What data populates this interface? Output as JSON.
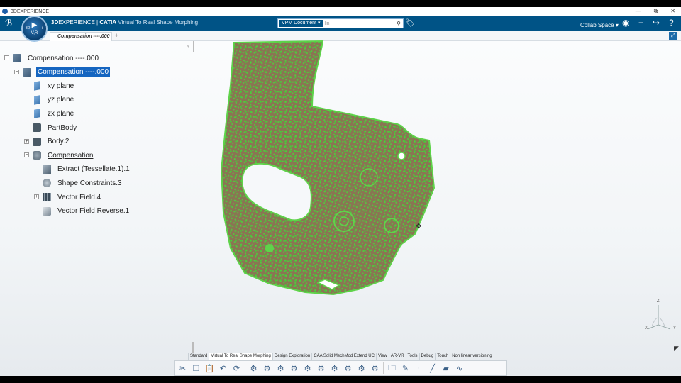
{
  "window": {
    "title": "3DEXPERIENCE",
    "controls": {
      "minimize": "—",
      "restore": "⧉",
      "close": "✕"
    }
  },
  "header": {
    "brand_bold": "3D",
    "brand_rest": "EXPERIENCE | ",
    "brand_catia": "CATIA",
    "app_name": "Virtual To Real Shape Morphing",
    "compass": {
      "left": "3D",
      "right": "i",
      "play": "▶",
      "version": "V,R"
    },
    "search": {
      "scope": "VPM Document",
      "value": "lin",
      "icon": "search-icon"
    },
    "collab_space": "Collab Space",
    "icons": [
      "tag-icon",
      "user-icon",
      "add-icon",
      "share-icon",
      "help-icon"
    ]
  },
  "tabs": [
    {
      "label": "Compensation ----.000",
      "active": true
    }
  ],
  "tree": {
    "nodes": [
      {
        "label": "Compensation ----.000",
        "icon": "product-icon",
        "depth": 0,
        "toggle": "minus",
        "selected": false,
        "underline": false
      },
      {
        "label": "Compensation ----.000",
        "icon": "part-icon",
        "depth": 1,
        "toggle": "minus",
        "selected": true,
        "underline": false
      },
      {
        "label": "xy plane",
        "icon": "plane-icon",
        "depth": 2,
        "toggle": "",
        "selected": false,
        "underline": false
      },
      {
        "label": "yz plane",
        "icon": "plane-icon",
        "depth": 2,
        "toggle": "",
        "selected": false,
        "underline": false
      },
      {
        "label": "zx plane",
        "icon": "plane-icon",
        "depth": 2,
        "toggle": "",
        "selected": false,
        "underline": false
      },
      {
        "label": "PartBody",
        "icon": "body-icon",
        "depth": 2,
        "toggle": "",
        "selected": false,
        "underline": false
      },
      {
        "label": "Body.2",
        "icon": "body-icon",
        "depth": 2,
        "toggle": "plus",
        "selected": false,
        "underline": false
      },
      {
        "label": "Compensation",
        "icon": "geoset-icon",
        "depth": 2,
        "toggle": "minus",
        "selected": false,
        "underline": true
      },
      {
        "label": "Extract (Tessellate.1).1",
        "icon": "tessellate-icon",
        "depth": 3,
        "toggle": "",
        "selected": false,
        "underline": false
      },
      {
        "label": "Shape Constraints.3",
        "icon": "shape-constraints-icon",
        "depth": 3,
        "toggle": "",
        "selected": false,
        "underline": false
      },
      {
        "label": "Vector Field.4",
        "icon": "vector-field-icon",
        "depth": 3,
        "toggle": "plus",
        "selected": false,
        "underline": false
      },
      {
        "label": "Vector Field Reverse.1",
        "icon": "vector-field-reverse-icon",
        "depth": 3,
        "toggle": "",
        "selected": false,
        "underline": false
      }
    ]
  },
  "axis": {
    "z": "Z",
    "x": "X",
    "y": "Y"
  },
  "action_tabs": [
    "Standard",
    "Virtual To Real Shape Morphing",
    "Design Exploration",
    "CAA Solid MechMod Extend UC",
    "View",
    "AR-VR",
    "Tools",
    "Debug",
    "Touch",
    "Non linear versioning"
  ],
  "active_action_tab": "Virtual To Real Shape Morphing",
  "toolbar_icons": [
    "cut-icon",
    "copy-icon",
    "paste-icon",
    "undo-icon",
    "update-icon",
    "morph-icon-1",
    "morph-icon-2",
    "morph-icon-3",
    "morph-icon-4",
    "morph-icon-5",
    "morph-icon-6",
    "morph-icon-7",
    "morph-icon-8",
    "morph-icon-9",
    "morph-icon-10",
    "folder-icon",
    "edit-icon",
    "point-icon",
    "line-icon",
    "plane-icon",
    "curve-icon"
  ],
  "colors": {
    "header_bg": "#005386",
    "selection": "#1565c0",
    "mesh_green": "#3ccf2f",
    "model_brown": "#8a7553"
  }
}
